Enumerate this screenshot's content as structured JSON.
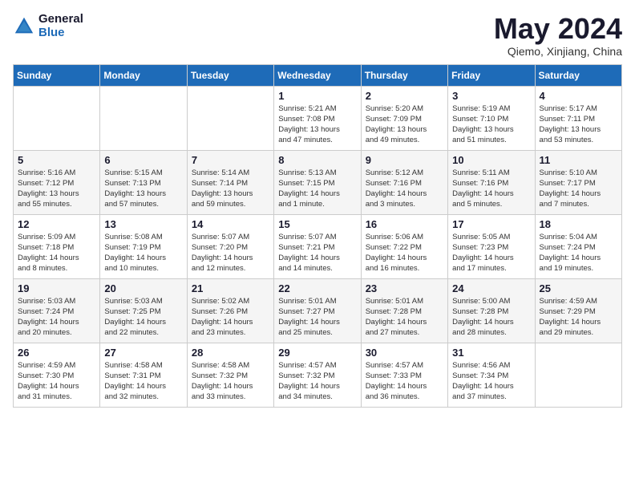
{
  "header": {
    "logo_general": "General",
    "logo_blue": "Blue",
    "month_title": "May 2024",
    "location": "Qiemo, Xinjiang, China"
  },
  "days_of_week": [
    "Sunday",
    "Monday",
    "Tuesday",
    "Wednesday",
    "Thursday",
    "Friday",
    "Saturday"
  ],
  "weeks": [
    [
      {
        "day": "",
        "info": ""
      },
      {
        "day": "",
        "info": ""
      },
      {
        "day": "",
        "info": ""
      },
      {
        "day": "1",
        "info": "Sunrise: 5:21 AM\nSunset: 7:08 PM\nDaylight: 13 hours\nand 47 minutes."
      },
      {
        "day": "2",
        "info": "Sunrise: 5:20 AM\nSunset: 7:09 PM\nDaylight: 13 hours\nand 49 minutes."
      },
      {
        "day": "3",
        "info": "Sunrise: 5:19 AM\nSunset: 7:10 PM\nDaylight: 13 hours\nand 51 minutes."
      },
      {
        "day": "4",
        "info": "Sunrise: 5:17 AM\nSunset: 7:11 PM\nDaylight: 13 hours\nand 53 minutes."
      }
    ],
    [
      {
        "day": "5",
        "info": "Sunrise: 5:16 AM\nSunset: 7:12 PM\nDaylight: 13 hours\nand 55 minutes."
      },
      {
        "day": "6",
        "info": "Sunrise: 5:15 AM\nSunset: 7:13 PM\nDaylight: 13 hours\nand 57 minutes."
      },
      {
        "day": "7",
        "info": "Sunrise: 5:14 AM\nSunset: 7:14 PM\nDaylight: 13 hours\nand 59 minutes."
      },
      {
        "day": "8",
        "info": "Sunrise: 5:13 AM\nSunset: 7:15 PM\nDaylight: 14 hours\nand 1 minute."
      },
      {
        "day": "9",
        "info": "Sunrise: 5:12 AM\nSunset: 7:16 PM\nDaylight: 14 hours\nand 3 minutes."
      },
      {
        "day": "10",
        "info": "Sunrise: 5:11 AM\nSunset: 7:16 PM\nDaylight: 14 hours\nand 5 minutes."
      },
      {
        "day": "11",
        "info": "Sunrise: 5:10 AM\nSunset: 7:17 PM\nDaylight: 14 hours\nand 7 minutes."
      }
    ],
    [
      {
        "day": "12",
        "info": "Sunrise: 5:09 AM\nSunset: 7:18 PM\nDaylight: 14 hours\nand 8 minutes."
      },
      {
        "day": "13",
        "info": "Sunrise: 5:08 AM\nSunset: 7:19 PM\nDaylight: 14 hours\nand 10 minutes."
      },
      {
        "day": "14",
        "info": "Sunrise: 5:07 AM\nSunset: 7:20 PM\nDaylight: 14 hours\nand 12 minutes."
      },
      {
        "day": "15",
        "info": "Sunrise: 5:07 AM\nSunset: 7:21 PM\nDaylight: 14 hours\nand 14 minutes."
      },
      {
        "day": "16",
        "info": "Sunrise: 5:06 AM\nSunset: 7:22 PM\nDaylight: 14 hours\nand 16 minutes."
      },
      {
        "day": "17",
        "info": "Sunrise: 5:05 AM\nSunset: 7:23 PM\nDaylight: 14 hours\nand 17 minutes."
      },
      {
        "day": "18",
        "info": "Sunrise: 5:04 AM\nSunset: 7:24 PM\nDaylight: 14 hours\nand 19 minutes."
      }
    ],
    [
      {
        "day": "19",
        "info": "Sunrise: 5:03 AM\nSunset: 7:24 PM\nDaylight: 14 hours\nand 20 minutes."
      },
      {
        "day": "20",
        "info": "Sunrise: 5:03 AM\nSunset: 7:25 PM\nDaylight: 14 hours\nand 22 minutes."
      },
      {
        "day": "21",
        "info": "Sunrise: 5:02 AM\nSunset: 7:26 PM\nDaylight: 14 hours\nand 23 minutes."
      },
      {
        "day": "22",
        "info": "Sunrise: 5:01 AM\nSunset: 7:27 PM\nDaylight: 14 hours\nand 25 minutes."
      },
      {
        "day": "23",
        "info": "Sunrise: 5:01 AM\nSunset: 7:28 PM\nDaylight: 14 hours\nand 27 minutes."
      },
      {
        "day": "24",
        "info": "Sunrise: 5:00 AM\nSunset: 7:28 PM\nDaylight: 14 hours\nand 28 minutes."
      },
      {
        "day": "25",
        "info": "Sunrise: 4:59 AM\nSunset: 7:29 PM\nDaylight: 14 hours\nand 29 minutes."
      }
    ],
    [
      {
        "day": "26",
        "info": "Sunrise: 4:59 AM\nSunset: 7:30 PM\nDaylight: 14 hours\nand 31 minutes."
      },
      {
        "day": "27",
        "info": "Sunrise: 4:58 AM\nSunset: 7:31 PM\nDaylight: 14 hours\nand 32 minutes."
      },
      {
        "day": "28",
        "info": "Sunrise: 4:58 AM\nSunset: 7:32 PM\nDaylight: 14 hours\nand 33 minutes."
      },
      {
        "day": "29",
        "info": "Sunrise: 4:57 AM\nSunset: 7:32 PM\nDaylight: 14 hours\nand 34 minutes."
      },
      {
        "day": "30",
        "info": "Sunrise: 4:57 AM\nSunset: 7:33 PM\nDaylight: 14 hours\nand 36 minutes."
      },
      {
        "day": "31",
        "info": "Sunrise: 4:56 AM\nSunset: 7:34 PM\nDaylight: 14 hours\nand 37 minutes."
      },
      {
        "day": "",
        "info": ""
      }
    ]
  ]
}
